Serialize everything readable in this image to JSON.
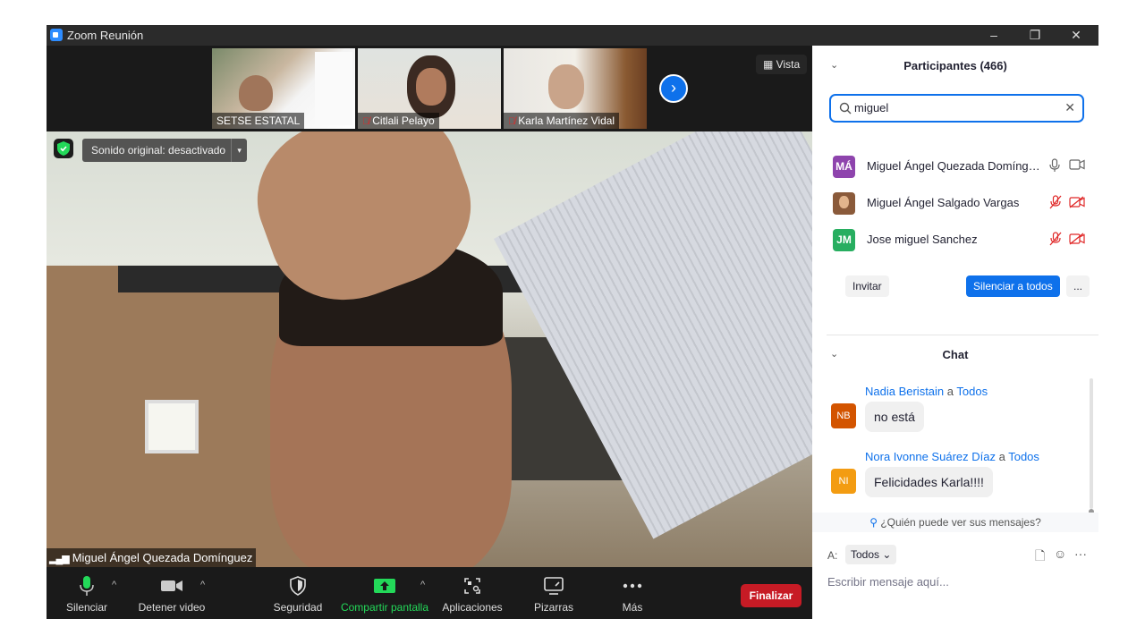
{
  "window": {
    "title": "Zoom Reunión",
    "minimize": "–",
    "restore": "❐",
    "close": "✕"
  },
  "video": {
    "thumbnails": [
      {
        "label": "SETSE ESTATAL",
        "muted": false
      },
      {
        "label": "Citlali Pelayo",
        "muted": true
      },
      {
        "label": "Karla Martínez Vidal",
        "muted": true
      }
    ],
    "next_arrow": "›",
    "view_button": "Vista",
    "sound_badge": "Sonido original: desactivado",
    "sound_caret": "▾",
    "active_speaker": "Miguel Ángel Quezada Domínguez",
    "signal_bars": "▂▄▆"
  },
  "toolbar": {
    "mute": "Silenciar",
    "stop_video": "Detener video",
    "security": "Seguridad",
    "share_screen": "Compartir pantalla",
    "apps": "Aplicaciones",
    "whiteboards": "Pizarras",
    "more": "Más",
    "end": "Finalizar",
    "caret": "^",
    "share_color": "#23d959"
  },
  "participants": {
    "header": "Participantes (466)",
    "chevron": "⌄",
    "search_value": "miguel",
    "clear": "✕",
    "list": [
      {
        "initials": "MÁ",
        "name": "Miguel Ángel Quezada Domínguez",
        "avatar_color": "#8e44ad",
        "muted": false,
        "video_off": false
      },
      {
        "initials": "",
        "name": "Miguel Ángel Salgado Vargas",
        "avatar_color": "#8a5a3a",
        "muted": true,
        "video_off": true
      },
      {
        "initials": "JM",
        "name": "Jose miguel Sanchez",
        "avatar_color": "#27ae60",
        "muted": true,
        "video_off": true
      }
    ],
    "invite": "Invitar",
    "mute_all": "Silenciar a todos",
    "more": "..."
  },
  "chat": {
    "header": "Chat",
    "chevron": "⌄",
    "messages": [
      {
        "initials": "NB",
        "from": "Nadia Beristain",
        "to_word": "a",
        "to": "Todos",
        "text": "no está",
        "avatar_color": "#d35400"
      },
      {
        "initials": "NI",
        "from": "Nora Ivonne Suárez Díaz",
        "to_word": "a",
        "to": "Todos",
        "text": "Felicidades Karla!!!!",
        "avatar_color": "#f39c12"
      }
    ],
    "who_can_see": "¿Quién puede ver sus mensajes?",
    "to_label": "A:",
    "to_value": "Todos ⌄",
    "input_placeholder": "Escribir mensaje aquí...",
    "more": "···"
  },
  "colors": {
    "accent": "#0e71eb",
    "end_red": "#c71b25",
    "mute_red": "#e02828"
  }
}
